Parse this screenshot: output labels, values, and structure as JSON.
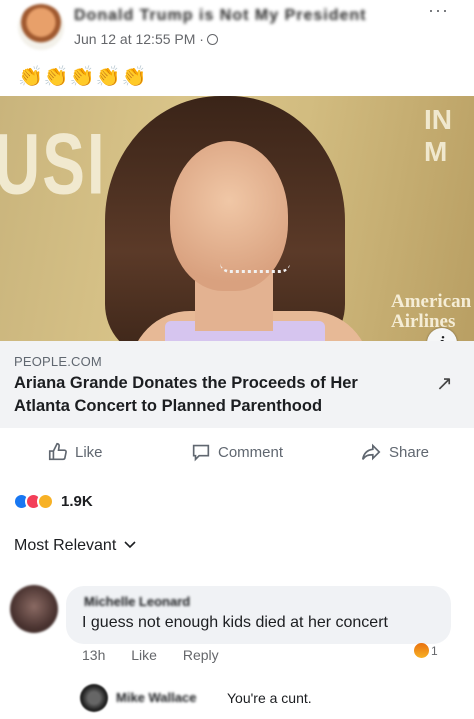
{
  "post": {
    "author": "Donald Trump is Not My President",
    "meta": "Jun 12 at 12:55 PM ·",
    "more": "···",
    "text": "👏👏👏👏👏"
  },
  "link": {
    "domain": "PEOPLE.COM",
    "title": "Ariana Grande Donates the Proceeds of Her Atlanta Concert to Planned Parenthood",
    "image_text_left": "USI",
    "image_text_right": "IN M",
    "image_brand": "American Airlines",
    "info_icon": "i",
    "arrow": "↗"
  },
  "actions": {
    "like": "Like",
    "comment": "Comment",
    "share": "Share"
  },
  "reactions": {
    "count": "1.9K"
  },
  "sort": {
    "label": "Most Relevant"
  },
  "comment": {
    "author": "Michelle Leonard",
    "text": "I guess not enough kids died at her concert",
    "time": "13h",
    "like": "Like",
    "reply": "Reply",
    "reaction_count": "1"
  },
  "reply": {
    "author": "Mike Wallace",
    "text": "You're a cunt."
  },
  "colors": {
    "accent": "#1877f2",
    "caption_bg": "#f2f3f5",
    "bubble_bg": "#f0f2f5"
  }
}
